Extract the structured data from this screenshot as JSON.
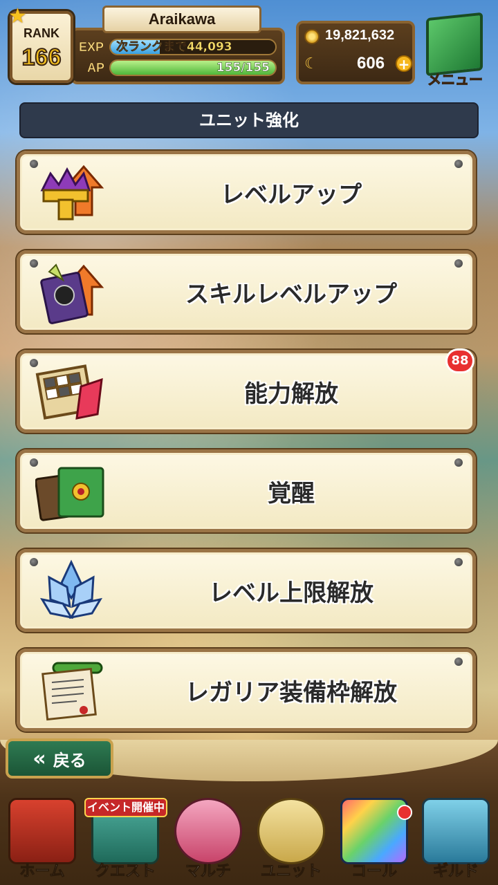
{
  "header": {
    "rank_label": "RANK",
    "rank_value": "166",
    "player_name": "Araikawa",
    "exp_label": "EXP",
    "exp_text": "次ランクまで44,093",
    "exp_fraction": 0.3,
    "ap_label": "AP",
    "ap_text": "155/155",
    "ap_fraction": 1.0,
    "coins": "19,821,632",
    "gems": "606",
    "menu_label": "メニュー"
  },
  "title": "ユニット強化",
  "menu_items": [
    {
      "label": "レベルアップ",
      "icon": "crown-levelup-icon"
    },
    {
      "label": "スキルレベルアップ",
      "icon": "skill-book-levelup-icon"
    },
    {
      "label": "能力解放",
      "icon": "ability-board-icon"
    },
    {
      "label": "覚醒",
      "icon": "awakening-book-icon"
    },
    {
      "label": "レベル上限解放",
      "icon": "crystal-lotus-icon"
    },
    {
      "label": "レガリア装備枠解放",
      "icon": "scroll-icon"
    }
  ],
  "badge_count": "88",
  "back_label": "戻る",
  "event_banner": "イベント開催中",
  "nav": [
    {
      "label": "ホーム",
      "icon": "home-icon"
    },
    {
      "label": "クエスト",
      "icon": "quest-icon"
    },
    {
      "label": "マルチ",
      "icon": "multi-icon"
    },
    {
      "label": "ユニット",
      "icon": "unit-icon"
    },
    {
      "label": "コール",
      "icon": "call-icon"
    },
    {
      "label": "ギルド",
      "icon": "guild-icon"
    }
  ]
}
